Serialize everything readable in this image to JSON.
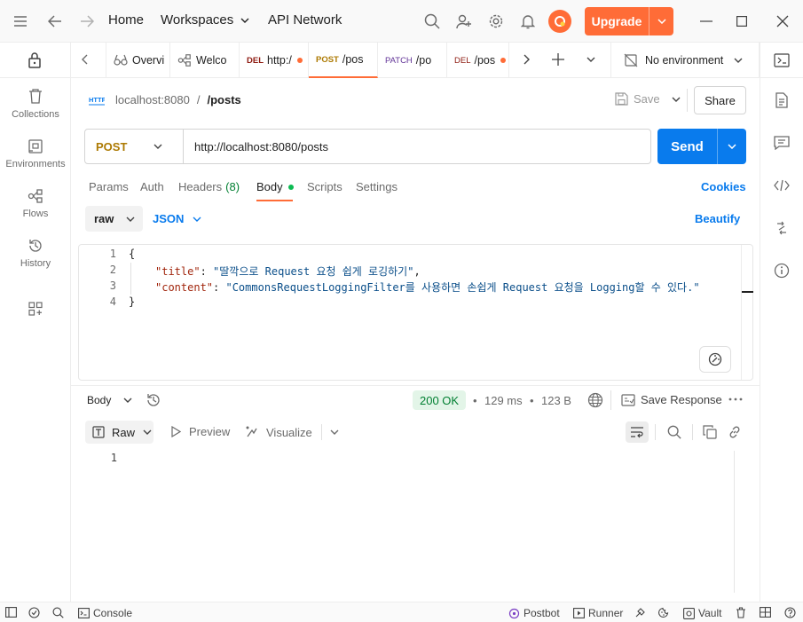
{
  "titlebar": {
    "home": "Home",
    "workspaces": "Workspaces",
    "api_network": "API Network",
    "upgrade": "Upgrade"
  },
  "sidebar": {
    "items": [
      {
        "label": "Collections",
        "icon": "trash-can-icon"
      },
      {
        "label": "Environments",
        "icon": "environment-icon"
      },
      {
        "label": "Flows",
        "icon": "flows-icon"
      },
      {
        "label": "History",
        "icon": "history-icon"
      }
    ]
  },
  "tabs": [
    {
      "method": "",
      "label": "Overvi",
      "icon": "overview-icon"
    },
    {
      "method": "",
      "label": "Welco",
      "icon": "flows-icon"
    },
    {
      "method": "DEL",
      "label": "http:/",
      "dot": true
    },
    {
      "method": "POST",
      "label": "/pos",
      "active": true
    },
    {
      "method": "PATCH",
      "label": "/po"
    },
    {
      "method": "DEL",
      "label": "/pos",
      "dot": true
    }
  ],
  "environment": "No environment",
  "request": {
    "breadcrumb_host": "localhost:8080",
    "breadcrumb_sep": "/",
    "breadcrumb_path": "/posts",
    "save": "Save",
    "share": "Share",
    "method": "POST",
    "url": "http://localhost:8080/posts",
    "send": "Send",
    "tabs": {
      "params": "Params",
      "auth": "Auth",
      "headers": "Headers",
      "headers_count": "(8)",
      "body": "Body",
      "scripts": "Scripts",
      "settings": "Settings"
    },
    "cookies": "Cookies",
    "body_mode": "raw",
    "body_format": "JSON",
    "beautify": "Beautify",
    "code": {
      "line1": "{",
      "title_key": "\"title\"",
      "title_val": "\"딸깍으로 Request 요청 쉽게 로깅하기\"",
      "content_key": "\"content\"",
      "content_val": "\"CommonsRequestLoggingFilter를 사용하면 손쉽게 Request 요청을 Logging할 수 있다.\"",
      "line4": "}",
      "line_numbers": [
        "1",
        "2",
        "3",
        "4"
      ]
    }
  },
  "response": {
    "body_label": "Body",
    "status": "200 OK",
    "time": "129 ms",
    "size": "123 B",
    "save_response": "Save Response",
    "raw": "Raw",
    "preview": "Preview",
    "visualize": "Visualize",
    "line1": "1"
  },
  "statusbar": {
    "console": "Console",
    "postbot": "Postbot",
    "runner": "Runner",
    "vault": "Vault"
  },
  "colors": {
    "accent": "#ff6c37",
    "send": "#097bed",
    "post_method": "#ad7a03",
    "status_ok": "#007f31"
  }
}
